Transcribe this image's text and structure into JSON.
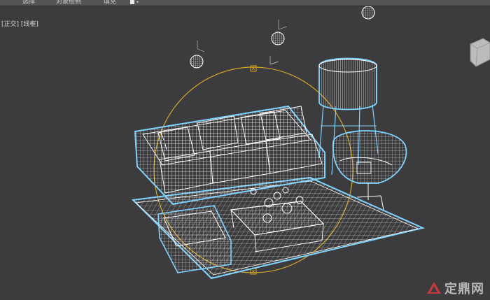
{
  "ribbon": {
    "tab_selection": "选择",
    "tab_object_paint": "对象绘制",
    "tab_fill": "填充",
    "lock_icon": "lock-icon"
  },
  "viewport": {
    "view_label": "[正交] [线框]",
    "view": "orthographic",
    "shading": "wireframe"
  },
  "watermark": {
    "text": "定鼎网",
    "logo_icon": "brand-logo-icon"
  },
  "colors": {
    "background": "#3c3c3e",
    "wireframe": "#ffffff",
    "selection_highlight": "#7fd3ff",
    "light_gizmo": "#e0b030"
  }
}
